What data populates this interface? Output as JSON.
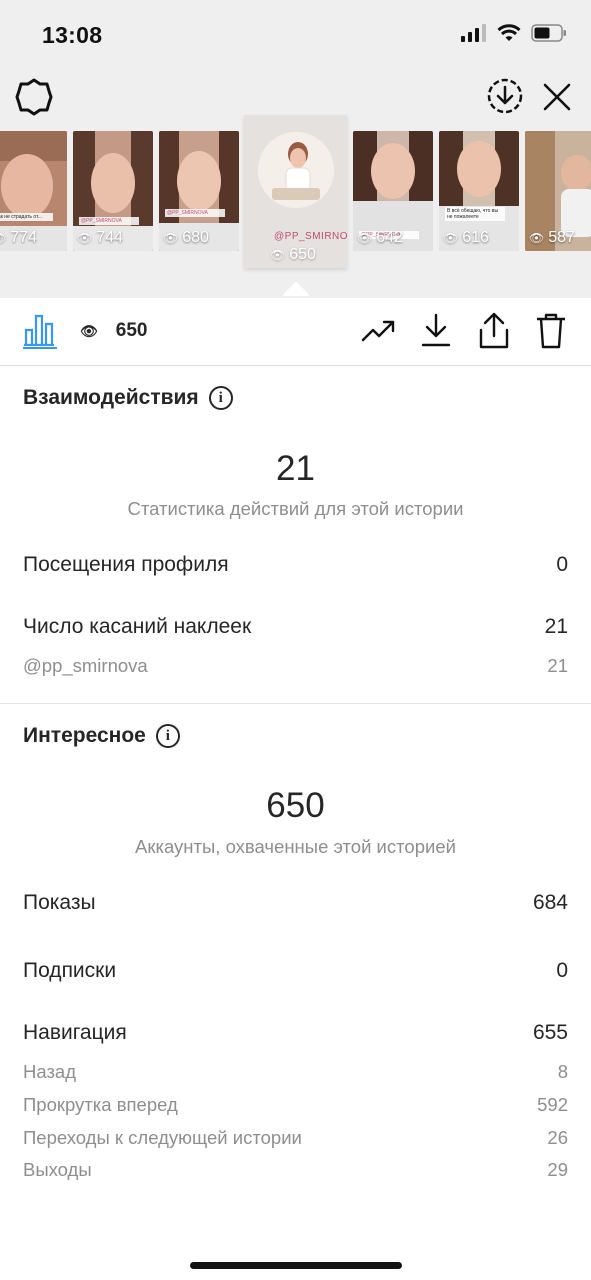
{
  "status_bar": {
    "time": "13:08"
  },
  "stories": [
    {
      "views": "774",
      "caption": "Как не страдать от..."
    },
    {
      "views": "744",
      "caption": "@PP_SMIRNOVA"
    },
    {
      "views": "680",
      "caption": "@PP_SMIRNOVA"
    },
    {
      "views": "650",
      "tag": "@PP_SMIRNOVA",
      "selected": true
    },
    {
      "views": "642",
      "caption": "@PP_SMIRNOVA"
    },
    {
      "views": "616",
      "caption": "В всё обещаю, что вы не пожалеете"
    },
    {
      "views": "587",
      "caption": ""
    }
  ],
  "toolbar": {
    "views": "650"
  },
  "interactions": {
    "title": "Взаимодействия",
    "total": "21",
    "total_label": "Статистика действий для этой истории",
    "rows": [
      {
        "label": "Посещения профиля",
        "value": "0"
      },
      {
        "label": "Число касаний наклеек",
        "value": "21"
      }
    ],
    "sub_rows": [
      {
        "label": "@pp_smirnova",
        "value": "21"
      }
    ]
  },
  "discovery": {
    "title": "Интересное",
    "total": "650",
    "total_label": "Аккаунты, охваченные этой историей",
    "rows": [
      {
        "label": "Показы",
        "value": "684"
      },
      {
        "label": "Подписки",
        "value": "0"
      },
      {
        "label": "Навигация",
        "value": "655"
      }
    ],
    "nav_rows": [
      {
        "label": "Назад",
        "value": "8"
      },
      {
        "label": "Прокрутка вперед",
        "value": "592"
      },
      {
        "label": "Переходы к следующей истории",
        "value": "26"
      },
      {
        "label": "Выходы",
        "value": "29"
      }
    ]
  },
  "colors": {
    "accent": "#3897f0",
    "text": "#262626",
    "muted": "#8e8e8e",
    "sticker": "#c04d73"
  }
}
